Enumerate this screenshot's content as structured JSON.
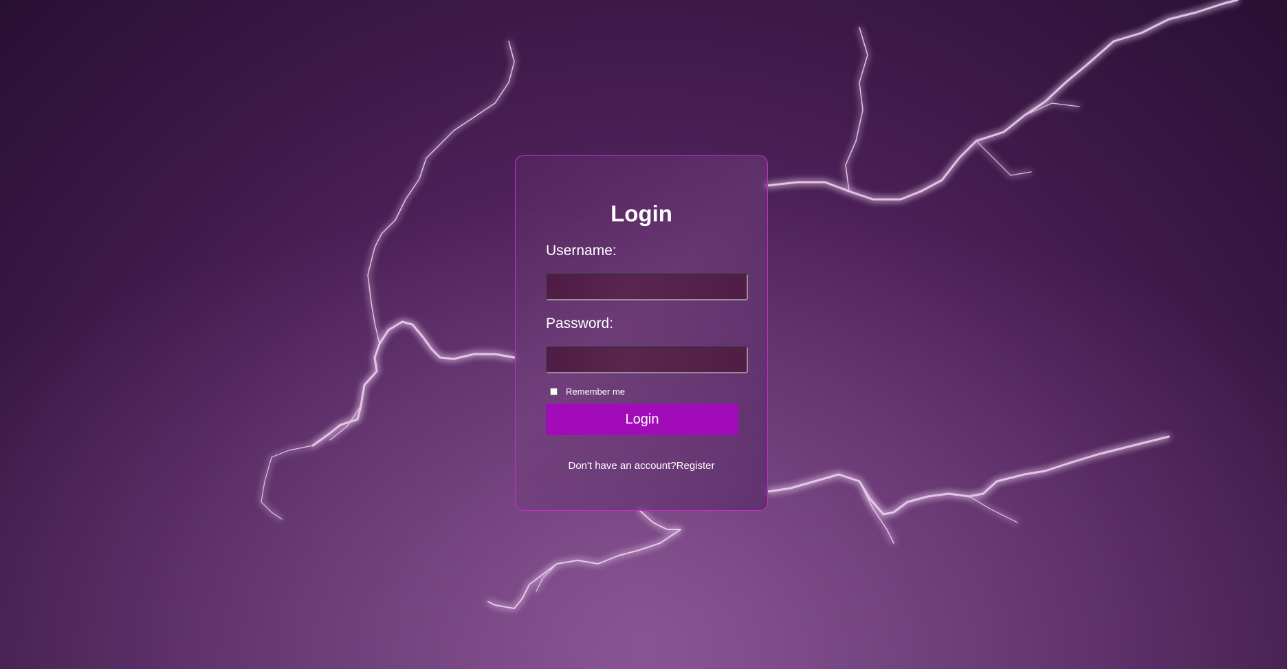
{
  "page": {
    "background_theme": "purple-lightning",
    "accent_color": "#a10cb8",
    "card_border_color": "#c030c8"
  },
  "login_form": {
    "title": "Login",
    "username_label": "Username:",
    "username_value": "",
    "password_label": "Password:",
    "password_value": "",
    "remember_label": "Remember me",
    "remember_checked": false,
    "submit_label": "Login",
    "register_prompt": "Don't have an account?",
    "register_link": "Register"
  }
}
